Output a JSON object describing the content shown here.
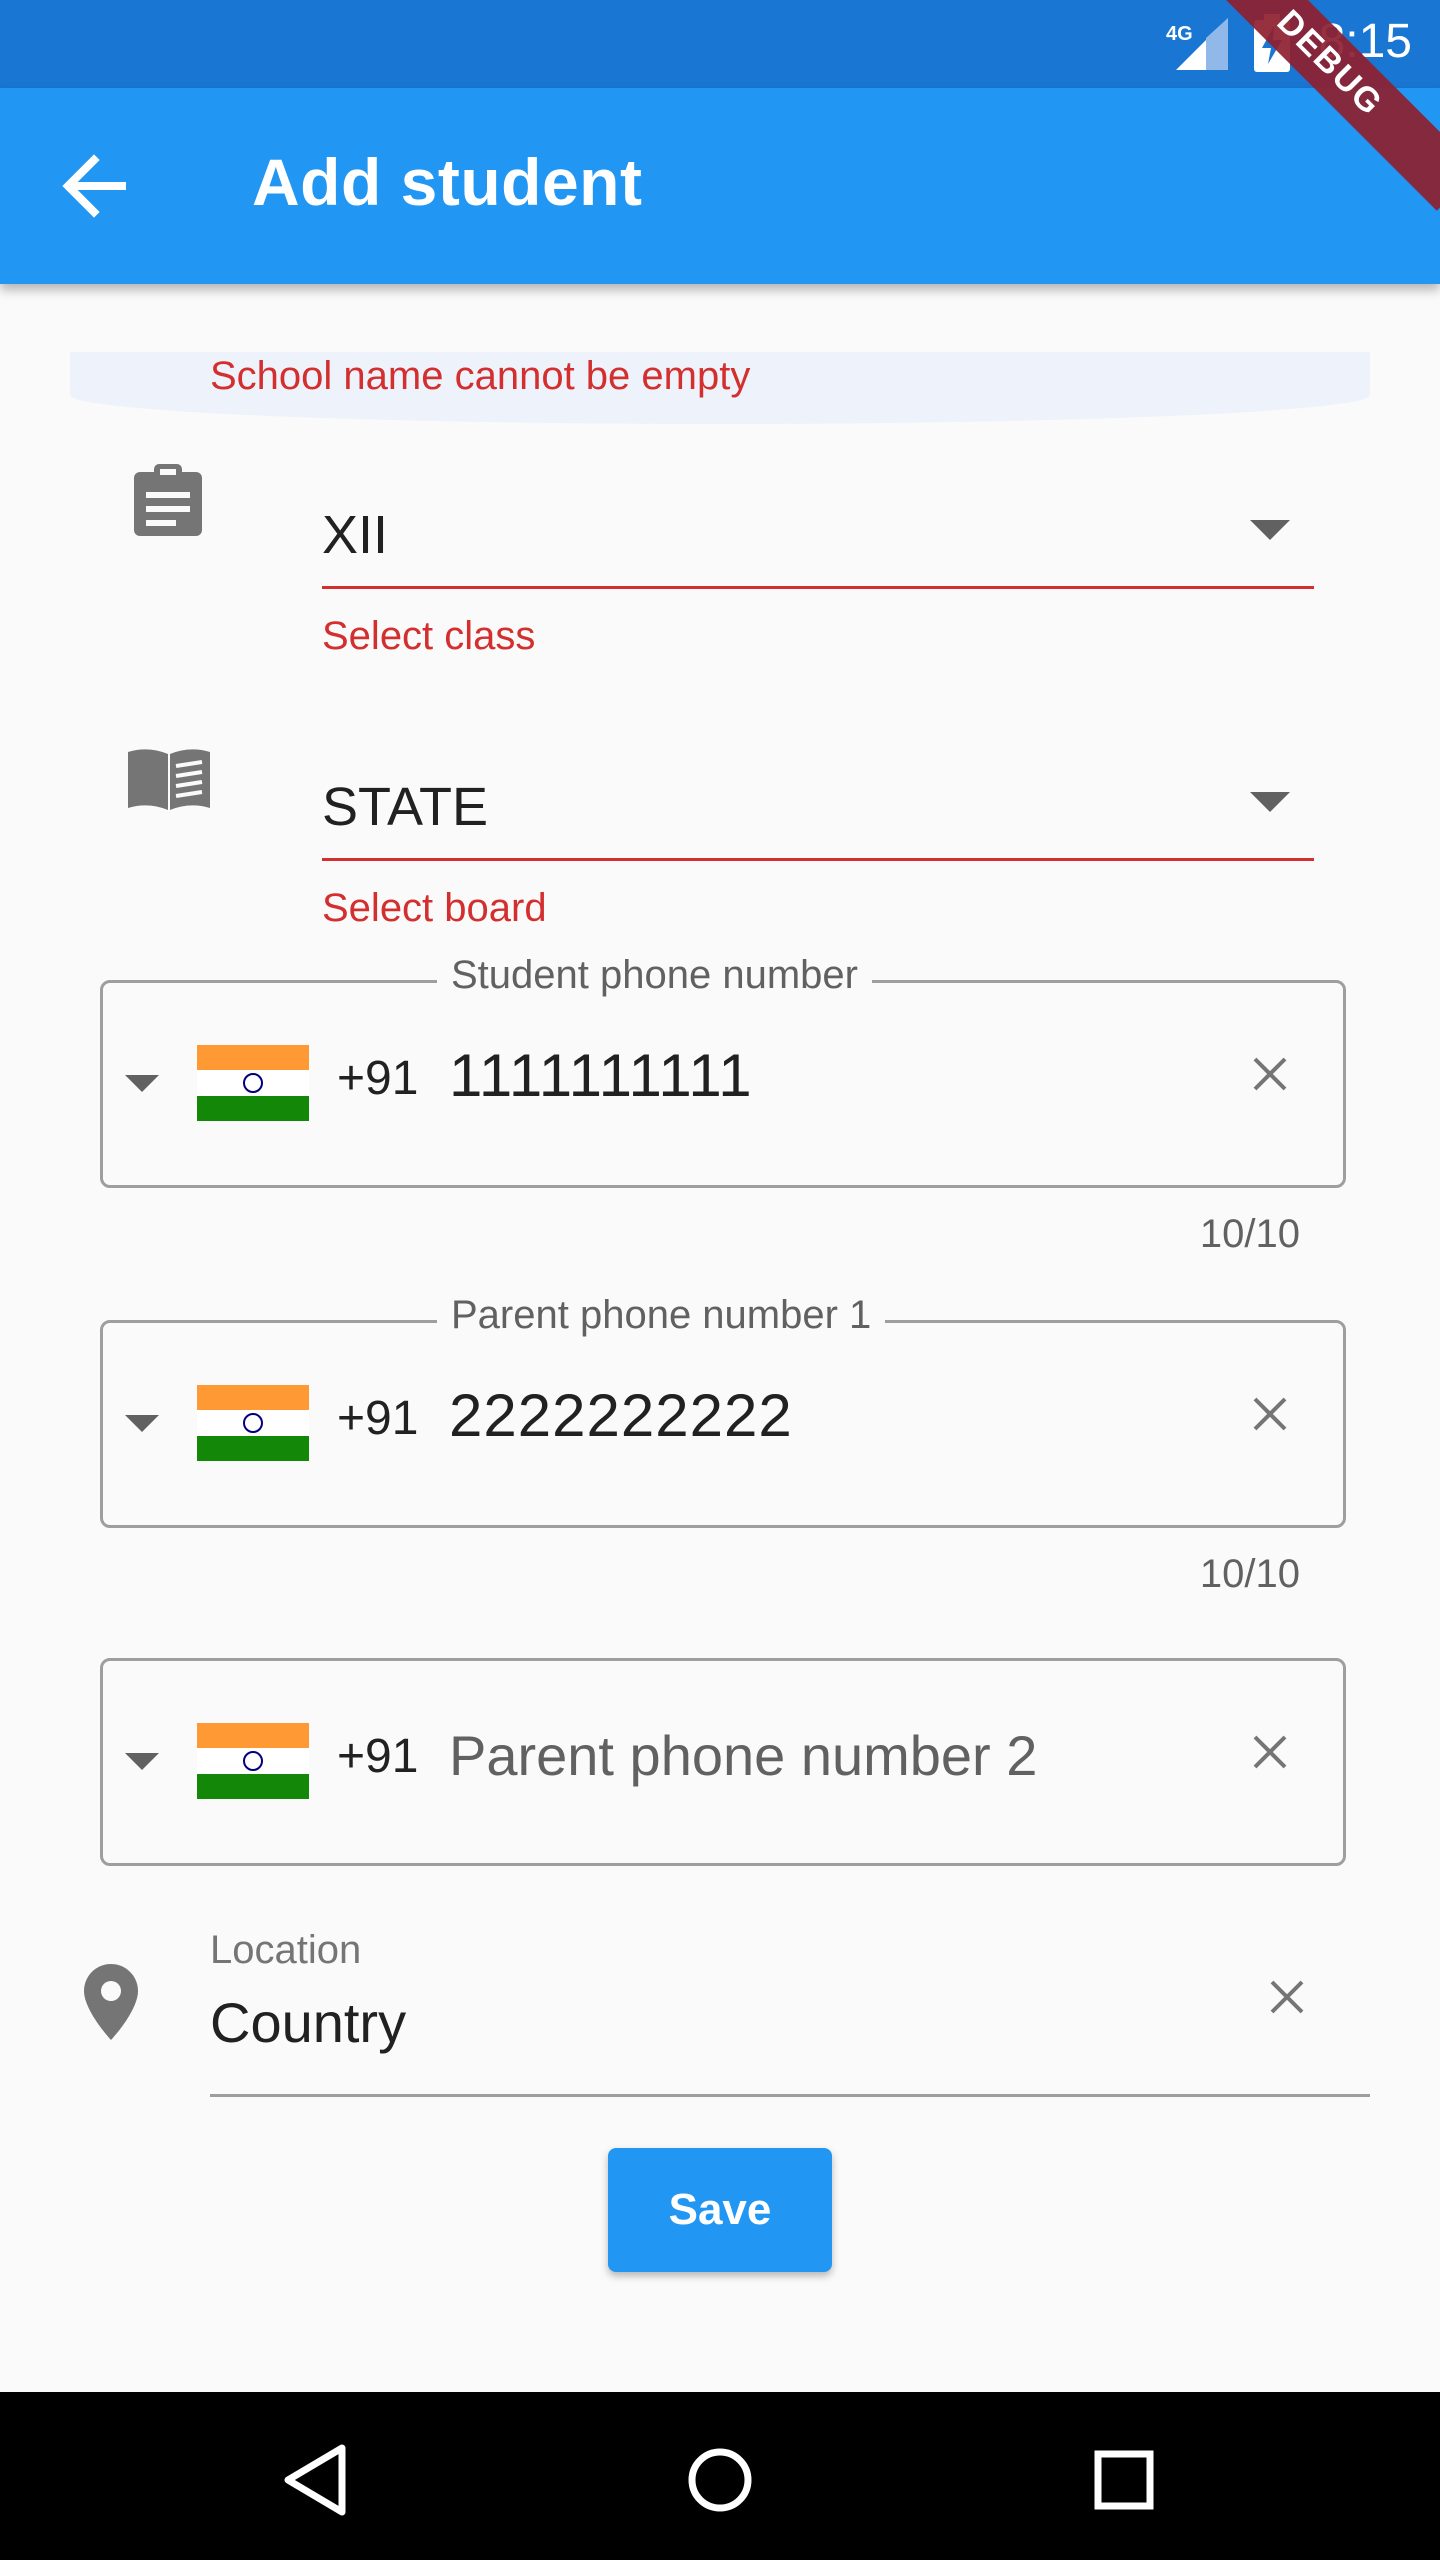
{
  "status_bar": {
    "time": "8:15",
    "network": "4G"
  },
  "debug_banner": "DEBUG",
  "app_bar": {
    "title": "Add student"
  },
  "school": {
    "error": "School name cannot be empty"
  },
  "class_field": {
    "value": "XII",
    "error": "Select class"
  },
  "board_field": {
    "value": "STATE",
    "error": "Select board"
  },
  "student_phone": {
    "label": "Student phone number",
    "dial_code": "+91",
    "value": "1111111111",
    "counter": "10/10"
  },
  "parent_phone_1": {
    "label": "Parent phone number 1",
    "dial_code": "+91",
    "value": "2222222222",
    "counter": "10/10"
  },
  "parent_phone_2": {
    "dial_code": "+91",
    "placeholder": "Parent phone number 2"
  },
  "location": {
    "label": "Location",
    "value": "Country"
  },
  "save_button": {
    "label": "Save"
  },
  "icons": {
    "back": "arrow-back-icon",
    "class": "assignment-icon",
    "board": "book-icon",
    "location": "location-pin-icon",
    "clear": "close-icon",
    "flag": "india-flag-icon"
  },
  "colors": {
    "primary": "#2196f3",
    "status_bar": "#1976d2",
    "error": "#d32f2f"
  }
}
